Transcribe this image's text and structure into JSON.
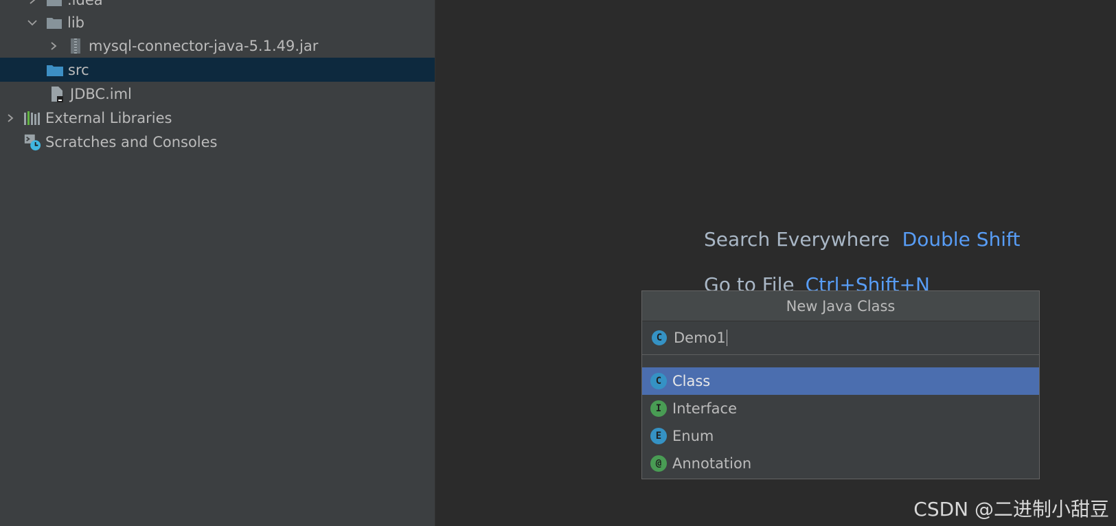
{
  "tree": {
    "items": [
      {
        "label": ".idea",
        "icon": "folder-icon"
      },
      {
        "label": "lib",
        "icon": "folder-icon"
      },
      {
        "label": "mysql-connector-java-5.1.49.jar",
        "icon": "jar-icon"
      },
      {
        "label": "src",
        "icon": "source-folder-icon"
      },
      {
        "label": "JDBC.iml",
        "icon": "module-file-icon"
      },
      {
        "label": "External Libraries",
        "icon": "libraries-icon"
      },
      {
        "label": "Scratches and Consoles",
        "icon": "scratches-icon"
      }
    ]
  },
  "editor_hints": [
    {
      "label": "Search Everywhere",
      "shortcut": "Double Shift"
    },
    {
      "label": "Go to File",
      "shortcut": "Ctrl+Shift+N"
    }
  ],
  "dialog": {
    "title": "New Java Class",
    "input_value": "Demo1",
    "input_icon": "C",
    "kinds": [
      {
        "badge": "C",
        "label": "Class",
        "color": "#3592c4"
      },
      {
        "badge": "I",
        "label": "Interface",
        "color": "#499c54"
      },
      {
        "badge": "E",
        "label": "Enum",
        "color": "#3592c4"
      },
      {
        "badge": "@",
        "label": "Annotation",
        "color": "#499c54"
      }
    ],
    "selected_kind": "Class"
  },
  "watermark": "CSDN @二进制小甜豆",
  "colors": {
    "sidebar_bg": "#3c3f41",
    "editor_bg": "#2b2b2b",
    "selection_tree": "#0d293e",
    "selection_list": "#4b6eaf",
    "shortcut_blue": "#589df6"
  }
}
